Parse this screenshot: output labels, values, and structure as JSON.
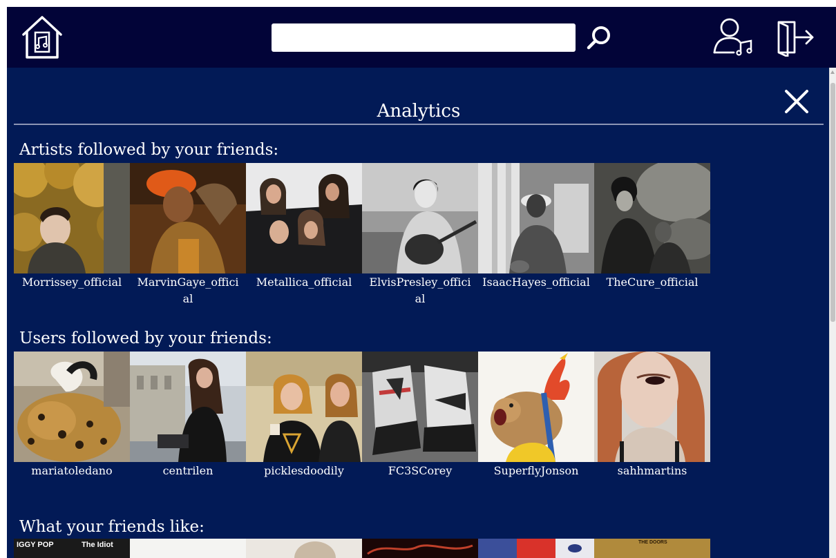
{
  "header": {
    "home_icon": "home-music-icon",
    "search": {
      "value": "",
      "placeholder": ""
    },
    "search_icon": "search-icon",
    "profile_icon": "user-music-icon",
    "logout_icon": "logout-icon"
  },
  "panel": {
    "title": "Analytics",
    "close_icon": "close-icon"
  },
  "sections": {
    "artists": {
      "heading": "Artists followed by your friends:",
      "items": [
        {
          "name": "Morrissey_official"
        },
        {
          "name": "MarvinGaye_official"
        },
        {
          "name": "Metallica_official"
        },
        {
          "name": "ElvisPresley_official"
        },
        {
          "name": "IsaacHayes_official"
        },
        {
          "name": "TheCure_official"
        }
      ]
    },
    "users": {
      "heading": "Users followed by your friends:",
      "items": [
        {
          "name": "mariatoledano"
        },
        {
          "name": "centrilen"
        },
        {
          "name": "picklesdoodily"
        },
        {
          "name": "FC3SCorey"
        },
        {
          "name": "SuperflyJonson"
        },
        {
          "name": "sahhmartins"
        }
      ]
    },
    "likes": {
      "heading": "What your friends like:",
      "visible_texts": [
        "IGGY POP",
        "The Idiot",
        "THE DOORS"
      ]
    }
  },
  "colors": {
    "topbar": "#020438",
    "panel": "#021a56",
    "text": "#ffffff"
  }
}
